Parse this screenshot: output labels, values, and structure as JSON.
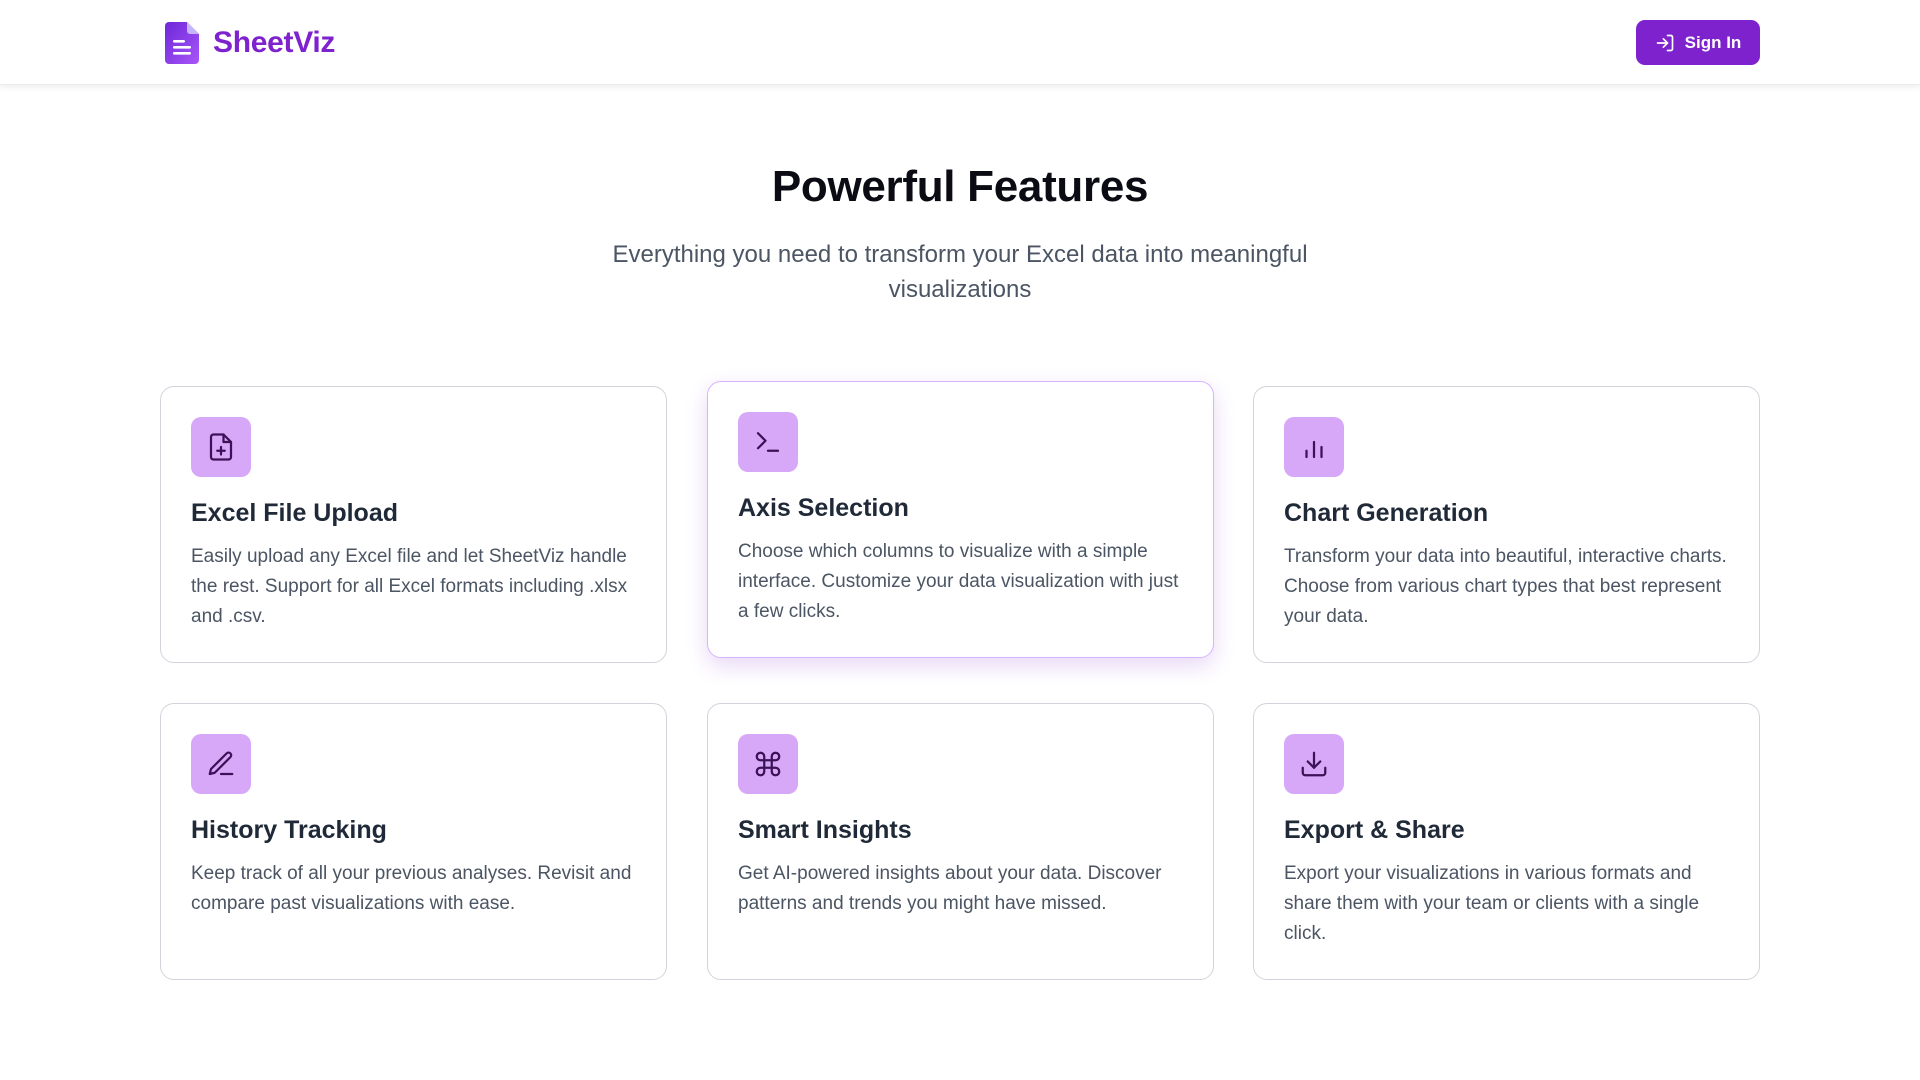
{
  "brand": {
    "name": "SheetViz",
    "accent_color": "#7e22ce"
  },
  "header": {
    "signin_label": "Sign In",
    "signin_icon": "log-in-icon"
  },
  "hero": {
    "title": "Powerful Features",
    "subtitle": "Everything you need to transform your Excel data into meaningful visualizations"
  },
  "features": [
    {
      "icon": "file-plus-icon",
      "title": "Excel File Upload",
      "description": "Easily upload any Excel file and let SheetViz handle the rest. Support for all Excel formats including .xlsx and .csv."
    },
    {
      "icon": "terminal-icon",
      "title": "Axis Selection",
      "description": "Choose which columns to visualize with a simple interface. Customize your data visualization with just a few clicks."
    },
    {
      "icon": "bar-chart-icon",
      "title": "Chart Generation",
      "description": "Transform your data into beautiful, interactive charts. Choose from various chart types that best represent your data."
    },
    {
      "icon": "pen-icon",
      "title": "History Tracking",
      "description": "Keep track of all your previous analyses. Revisit and compare past visualizations with ease."
    },
    {
      "icon": "command-icon",
      "title": "Smart Insights",
      "description": "Get AI-powered insights about your data. Discover patterns and trends you might have missed."
    },
    {
      "icon": "download-icon",
      "title": "Export & Share",
      "description": "Export your visualizations in various formats and share them with your team or clients with a single click."
    }
  ]
}
